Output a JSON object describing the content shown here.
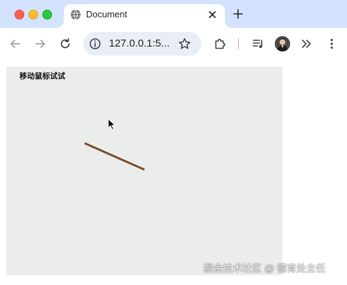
{
  "browser": {
    "tab": {
      "title": "Document"
    },
    "address_bar": {
      "url": "127.0.0.1:5..."
    }
  },
  "page": {
    "heading_text": "移动鼠标试试"
  },
  "watermark": {
    "text": "掘金技术社区 @ 德育处主任"
  },
  "colors": {
    "tabstrip_bg": "#d3e3fd",
    "canvas_bg": "#ebedec",
    "stick_color": "#7a4a2a",
    "close_red": "#ff5f57",
    "minimize_yellow": "#febc2e",
    "zoom_green": "#28c840"
  },
  "icons": {
    "favicon": "globe-icon",
    "tab_close": "close-icon",
    "new_tab": "plus-icon",
    "back": "arrow-left-icon",
    "forward": "arrow-right-icon",
    "reload": "reload-icon",
    "site_info": "info-icon",
    "bookmark": "star-icon",
    "extensions": "puzzle-icon",
    "media": "playlist-icon",
    "more_tools": "chevron-double-right-icon",
    "menu": "kebab-menu-icon",
    "cursor": "mouse-pointer-icon"
  }
}
